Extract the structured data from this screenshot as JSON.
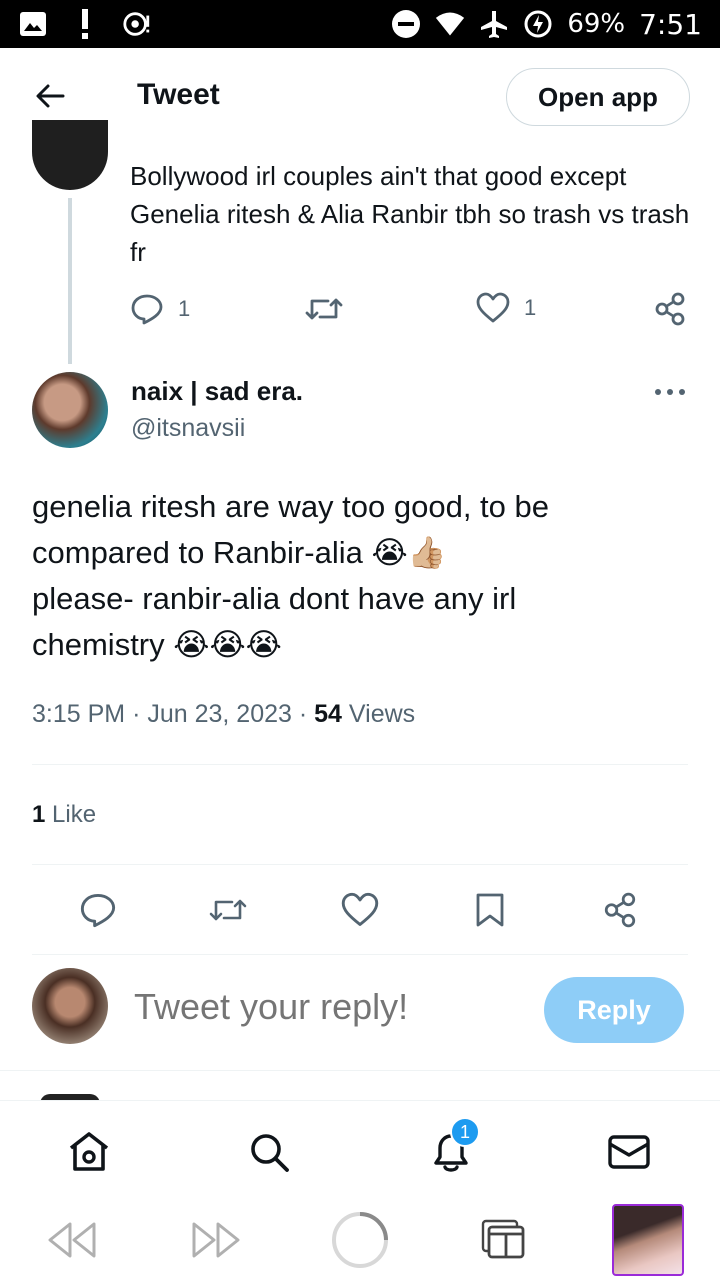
{
  "status_bar": {
    "battery": "69%",
    "time": "7:51",
    "icons": [
      "gallery-icon",
      "alert-icon",
      "chromecast-icon",
      "dnd-icon",
      "wifi-icon",
      "airplane-icon",
      "battery-charging-icon"
    ]
  },
  "header": {
    "title": "Tweet",
    "open_app_label": "Open app"
  },
  "previous_tweet": {
    "text": "Bollywood irl couples ain't that good except Genelia ritesh & Alia Ranbir tbh so trash vs trash fr",
    "reply_count": "1",
    "like_count": "1"
  },
  "tweet": {
    "author_name": "naix | sad era.",
    "author_handle": "@itsnavsii",
    "body_line1": "genelia ritesh are way too good, to be",
    "body_line2": "compared to Ranbir-alia 😭👍🏼",
    "body_line3": "please- ranbir-alia dont have any irl",
    "body_line4": "chemistry 😭😭😭",
    "time": "3:15 PM",
    "date": "Jun 23, 2023",
    "views_count": "54",
    "views_label": "Views",
    "likes_count": "1",
    "likes_label": "Like"
  },
  "reply": {
    "placeholder": "Tweet your reply!",
    "button_label": "Reply"
  },
  "bottom_nav": {
    "items": [
      "home-icon",
      "search-icon",
      "notifications-icon",
      "messages-icon"
    ],
    "notification_badge": "1"
  },
  "colors": {
    "accent": "#1d9bf0",
    "reply_button": "#8ecdf7",
    "secondary_text": "#536471"
  }
}
